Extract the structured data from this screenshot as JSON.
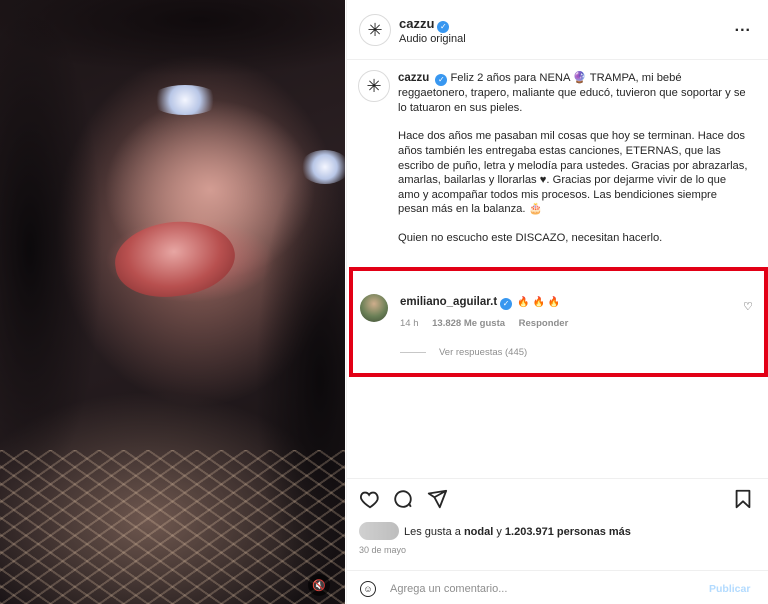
{
  "header": {
    "username": "cazzu",
    "audio": "Audio original",
    "more": "..."
  },
  "caption": {
    "username": "cazzu",
    "p1": "Feliz 2 años para NENA 🔮 TRAMPA, mi bebé reggaetonero, trapero, maliante que educó, tuvieron que soportar y se lo tatuaron en sus pieles.",
    "p2": "Hace dos años me pasaban mil cosas que hoy se terminan. Hace dos años también les entregaba estas canciones, ETERNAS, que las escribo de puño, letra y melodía para ustedes. Gracias por abrazarlas, amarlas, bailarlas y llorarlas ♥. Gracias por dejarme vivir de lo que amo y acompañar todos mis procesos. Las bendiciones siempre pesan más en la balanza. 🎂",
    "p3": "Quien no escucho este DISCAZO, necesitan hacerlo."
  },
  "comment": {
    "username": "emiliano_aguilar.t",
    "emojis": "🔥 🔥 🔥",
    "time": "14 h",
    "likes": "13.828 Me gusta",
    "reply": "Responder",
    "view_replies": "Ver respuestas (445)"
  },
  "likes": {
    "prefix": "Les gusta a",
    "user": "nodal",
    "connector": "y",
    "count": "1.203.971 personas más"
  },
  "date": "30 de mayo",
  "add_comment": {
    "placeholder": "Agrega un comentario...",
    "publish": "Publicar"
  },
  "icons": {
    "like": "heart-icon",
    "comment": "comment-icon",
    "share": "share-icon",
    "save": "bookmark-icon",
    "emoji": "emoji-icon",
    "mute": "mute-icon",
    "verified": "verified-badge-icon"
  },
  "colors": {
    "highlight": "#e20016",
    "verified": "#3897f0",
    "muted_text": "#8e8e8e"
  }
}
